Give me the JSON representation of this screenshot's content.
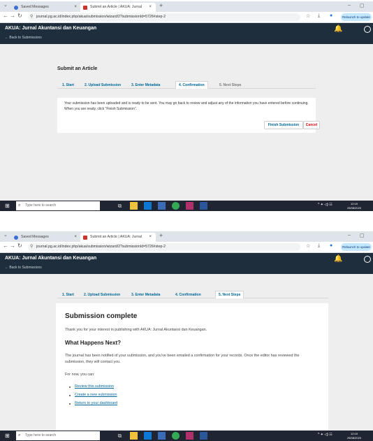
{
  "browser": {
    "inactive_tab": "Saved Messages",
    "active_tab": "Submit an Article | AKUA: Jurnal",
    "new_tab_icon": "+",
    "url": "journal.pg.ac.id/index.php/akua/submission/wizard/2?submissionId=5726#step-2",
    "relaunch": "Relaunch to update"
  },
  "app": {
    "title": "AKUA: Jurnal Akuntansi dan Keuangan",
    "back": "← Back to Submissions"
  },
  "screen1": {
    "heading": "Submit an Article",
    "steps": [
      "1. Start",
      "2. Upload Submission",
      "3. Enter Metadata",
      "4. Confirmation",
      "5. Next Steps"
    ],
    "active_step": 3,
    "message": "Your submission has been uploaded and is ready to be sent. You may go back to review and adjust any of the information you have entered before continuing. When you are ready, click \"Finish Submission\".",
    "finish_button": "Finish Submission",
    "cancel_button": "Cancel"
  },
  "screen2": {
    "steps": [
      "1. Start",
      "2. Upload Submission",
      "3. Enter Metadata",
      "4. Confirmation",
      "5. Next Steps"
    ],
    "active_step": 4,
    "title": "Submission complete",
    "thanks": "Thank you for your interest in publishing with AKUA: Jurnal Akuntansi dan Keuangan.",
    "next_heading": "What Happens Next?",
    "notified": "The journal has been notified of your submission, and you've been emailed a confirmation for your records. Once the editor has reviewed the submission, they will contact you.",
    "for_now": "For now, you can:",
    "links": [
      "Review this submission",
      "Create a new submission",
      "Return to your dashboard"
    ]
  },
  "taskbar": {
    "search_placeholder": "Type here to search",
    "time": "12:19",
    "date": "25/08/2023"
  },
  "colors": {
    "header": "#1e2e3c",
    "link": "#006798",
    "cancel": "#d00a0a"
  }
}
